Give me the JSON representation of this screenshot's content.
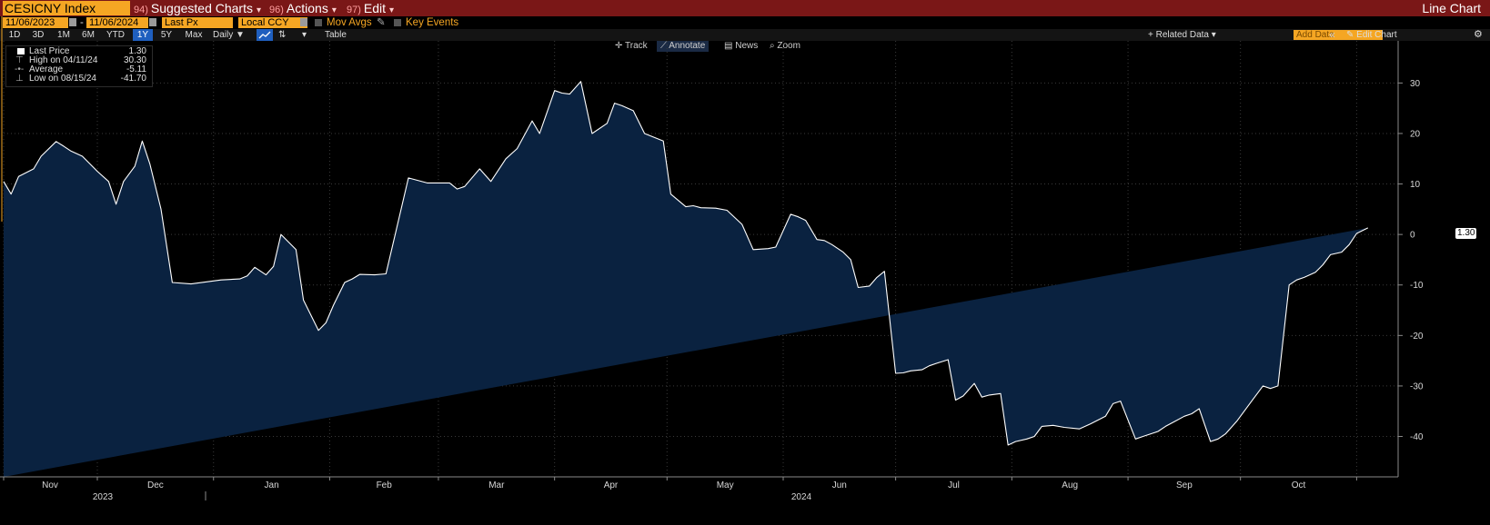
{
  "header": {
    "ticker": "CESICNY Index",
    "menus": [
      {
        "num": "94)",
        "label": "Suggested Charts"
      },
      {
        "num": "96)",
        "label": "Actions"
      },
      {
        "num": "97)",
        "label": "Edit"
      }
    ],
    "chart_type": "Line Chart"
  },
  "controls": {
    "start_date": "11/06/2023",
    "date_sep": "-",
    "end_date": "11/06/2024",
    "field": "Last Px",
    "currency": "Local CCY",
    "mov_avgs": "Mov Avgs",
    "key_events": "Key Events"
  },
  "periods": [
    "1D",
    "3D",
    "1M",
    "6M",
    "YTD",
    "1Y",
    "5Y",
    "Max"
  ],
  "selected_period": "1Y",
  "frequency": "Daily ▼",
  "table_label": "Table",
  "right_tools": {
    "related": "+ Related Data ▾",
    "add_data": "Add Data",
    "collapse": "«",
    "edit_chart": "✎ Edit Chart",
    "settings": "⚙"
  },
  "toolbar": [
    {
      "icon": "crosshair-icon",
      "glyph": "✛",
      "label": "Track"
    },
    {
      "icon": "pencil-icon",
      "glyph": "⟋",
      "label": "Annotate"
    },
    {
      "icon": "news-icon",
      "glyph": "▤",
      "label": "News"
    },
    {
      "icon": "zoom-icon",
      "glyph": "⌕",
      "label": "Zoom"
    }
  ],
  "legend": {
    "last_label": "Last Price",
    "last_value": "1.30",
    "high_label": "High on 04/11/24",
    "high_value": "30.30",
    "avg_label": "Average",
    "avg_value": "-5.11",
    "low_label": "Low on 08/15/24",
    "low_value": "-41.70"
  },
  "last_value_box": "1.30",
  "colors": {
    "area": "#0a2240",
    "line": "#ffffff",
    "accent": "#f5a623",
    "header": "#7a1717"
  },
  "chart_data": {
    "type": "area",
    "title": "",
    "xlabel": "",
    "ylabel": "",
    "ylim": [
      -48,
      36
    ],
    "yticks": [
      30,
      20,
      10,
      0,
      -10,
      -20,
      -30,
      -40
    ],
    "x_month_labels": [
      "Nov",
      "Dec",
      "Jan",
      "Feb",
      "Mar",
      "Apr",
      "May",
      "Jun",
      "Jul",
      "Aug",
      "Sep",
      "Oct"
    ],
    "x_year_labels": [
      "2023",
      "2024"
    ],
    "grid": true,
    "legend": "top-left",
    "x": [
      "2023-11-06",
      "2023-11-08",
      "2023-11-10",
      "2023-11-14",
      "2023-11-16",
      "2023-11-20",
      "2023-11-22",
      "2023-11-24",
      "2023-11-27",
      "2023-12-01",
      "2023-12-04",
      "2023-12-06",
      "2023-12-08",
      "2023-12-11",
      "2023-12-13",
      "2023-12-15",
      "2023-12-18",
      "2023-12-21",
      "2023-12-26",
      "2024-01-03",
      "2024-01-08",
      "2024-01-10",
      "2024-01-12",
      "2024-01-15",
      "2024-01-17",
      "2024-01-19",
      "2024-01-23",
      "2024-01-25",
      "2024-01-29",
      "2024-01-31",
      "2024-02-02",
      "2024-02-05",
      "2024-02-07",
      "2024-02-09",
      "2024-02-13",
      "2024-02-16",
      "2024-02-22",
      "2024-02-27",
      "2024-03-01",
      "2024-03-04",
      "2024-03-06",
      "2024-03-08",
      "2024-03-12",
      "2024-03-15",
      "2024-03-19",
      "2024-03-22",
      "2024-03-26",
      "2024-03-28",
      "2024-04-01",
      "2024-04-03",
      "2024-04-05",
      "2024-04-08",
      "2024-04-11",
      "2024-04-15",
      "2024-04-17",
      "2024-04-19",
      "2024-04-22",
      "2024-04-25",
      "2024-04-30",
      "2024-05-02",
      "2024-05-06",
      "2024-05-08",
      "2024-05-10",
      "2024-05-14",
      "2024-05-17",
      "2024-05-21",
      "2024-05-24",
      "2024-05-28",
      "2024-05-30",
      "2024-06-03",
      "2024-06-05",
      "2024-06-07",
      "2024-06-10",
      "2024-06-12",
      "2024-06-14",
      "2024-06-17",
      "2024-06-19",
      "2024-06-21",
      "2024-06-24",
      "2024-06-26",
      "2024-06-28",
      "2024-07-01",
      "2024-07-03",
      "2024-07-05",
      "2024-07-08",
      "2024-07-10",
      "2024-07-12",
      "2024-07-15",
      "2024-07-17",
      "2024-07-19",
      "2024-07-22",
      "2024-07-24",
      "2024-07-26",
      "2024-07-29",
      "2024-07-31",
      "2024-08-02",
      "2024-08-05",
      "2024-08-07",
      "2024-08-09",
      "2024-08-12",
      "2024-08-15",
      "2024-08-19",
      "2024-08-22",
      "2024-08-26",
      "2024-08-28",
      "2024-08-30",
      "2024-09-03",
      "2024-09-05",
      "2024-09-09",
      "2024-09-11",
      "2024-09-13",
      "2024-09-16",
      "2024-09-18",
      "2024-09-20",
      "2024-09-23",
      "2024-09-25",
      "2024-09-27",
      "2024-09-30",
      "2024-10-02",
      "2024-10-04",
      "2024-10-07",
      "2024-10-09",
      "2024-10-11",
      "2024-10-14",
      "2024-10-16",
      "2024-10-18",
      "2024-10-21",
      "2024-10-23",
      "2024-10-25",
      "2024-10-28",
      "2024-10-30",
      "2024-11-01",
      "2024-11-04",
      "2024-11-06"
    ],
    "series": [
      {
        "values": [
          10.5,
          8,
          11.5,
          13,
          15.5,
          18.4,
          17.5,
          16.5,
          15.5,
          12.5,
          10.5,
          6,
          10.5,
          13.5,
          18.5,
          14,
          5,
          -9.5,
          -9.8,
          -9,
          -8.8,
          -8.2,
          -6.5,
          -8,
          -6.3,
          0,
          -3,
          -13,
          -19,
          -17.5,
          -14,
          -9.5,
          -8.8,
          -7.9,
          -8,
          -7.8,
          11.2,
          10.2,
          10.2,
          10.2,
          9,
          9.5,
          13,
          10.5,
          15,
          17,
          22.5,
          20,
          28.5,
          28,
          27.8,
          30.3,
          20,
          22,
          26,
          25.5,
          24.5,
          20,
          18.5,
          8,
          5.5,
          5.7,
          5.3,
          5.2,
          4.8,
          2,
          -3,
          -2.8,
          -2.5,
          4,
          3.5,
          2.8,
          -1,
          -1.2,
          -2,
          -3.5,
          -5,
          -10.5,
          -10.2,
          -8.5,
          -7.3,
          -27.5,
          -27.4,
          -27,
          -26.8,
          -26,
          -25.5,
          -24.8,
          -32.8,
          -32,
          -29.5,
          -32.2,
          -31.8,
          -31.5,
          -41.7,
          -41,
          -40.5,
          -40,
          -38,
          -37.8,
          -38.2,
          -38.5,
          -37.5,
          -36,
          -33.5,
          -33,
          -40.5,
          -40,
          -39,
          -38,
          -37.2,
          -36,
          -35.5,
          -34.5,
          -41,
          -40.5,
          -39.5,
          -37,
          -35,
          -33,
          -30,
          -30.5,
          -30,
          -10,
          -9,
          -8.5,
          -7.5,
          -6,
          -4,
          -3.5,
          -2,
          0.2,
          1.3
        ]
      }
    ]
  }
}
